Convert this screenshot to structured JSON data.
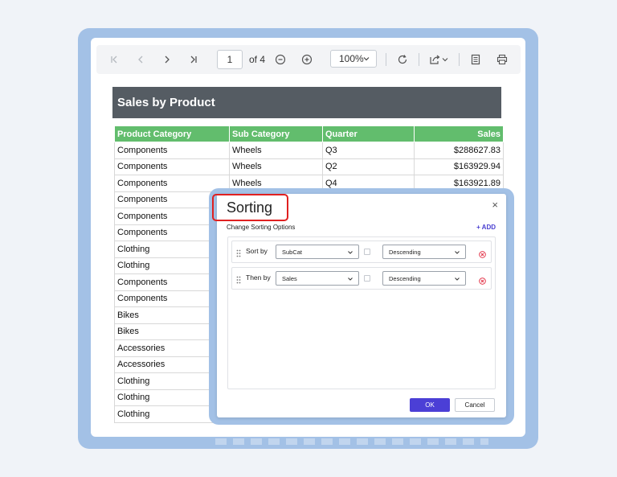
{
  "toolbar": {
    "current_page": "1",
    "page_of": "of 4",
    "zoom_level": "100%",
    "icons": [
      "first-page-icon",
      "prev-page-icon",
      "next-page-icon",
      "last-page-icon",
      "zoom-out-icon",
      "zoom-in-icon",
      "zoom-dropdown-icon",
      "refresh-icon",
      "export-icon",
      "export-dropdown-icon",
      "document-icon",
      "print-icon"
    ]
  },
  "report": {
    "title": "Sales by Product",
    "columns": [
      "Product Category",
      "Sub Category",
      "Quarter",
      "Sales"
    ],
    "rows": [
      [
        "Components",
        "Wheels",
        "Q3",
        "$288627.83"
      ],
      [
        "Components",
        "Wheels",
        "Q2",
        "$163929.94"
      ],
      [
        "Components",
        "Wheels",
        "Q4",
        "$163921.89"
      ],
      [
        "Components",
        "",
        "",
        ""
      ],
      [
        "Components",
        "",
        "",
        ""
      ],
      [
        "Components",
        "",
        "",
        ""
      ],
      [
        "Clothing",
        "",
        "",
        ""
      ],
      [
        "Clothing",
        "",
        "",
        ""
      ],
      [
        "Components",
        "",
        "",
        ""
      ],
      [
        "Components",
        "",
        "",
        ""
      ],
      [
        "Bikes",
        "",
        "",
        ""
      ],
      [
        "Bikes",
        "",
        "",
        ""
      ],
      [
        "Accessories",
        "",
        "",
        ""
      ],
      [
        "Accessories",
        "",
        "",
        ""
      ],
      [
        "Clothing",
        "",
        "",
        ""
      ],
      [
        "Clothing",
        "",
        "",
        ""
      ],
      [
        "Clothing",
        "",
        "",
        ""
      ]
    ]
  },
  "dialog": {
    "title": "Sorting",
    "close_symbol": "×",
    "subtitle": "Change Sorting Options",
    "add_label": "+ ADD",
    "rows": [
      {
        "label": "Sort by",
        "field": "SubCat",
        "order": "Descending"
      },
      {
        "label": "Then by",
        "field": "Sales",
        "order": "Descending"
      }
    ],
    "ok_label": "OK",
    "cancel_label": "Cancel"
  },
  "colors": {
    "frame": "#a3c1e6",
    "title_bar": "#555c63",
    "table_header": "#62bd6d",
    "primary_button": "#4b3fd6",
    "highlight": "#e02020",
    "remove_icon": "#e0243a"
  }
}
